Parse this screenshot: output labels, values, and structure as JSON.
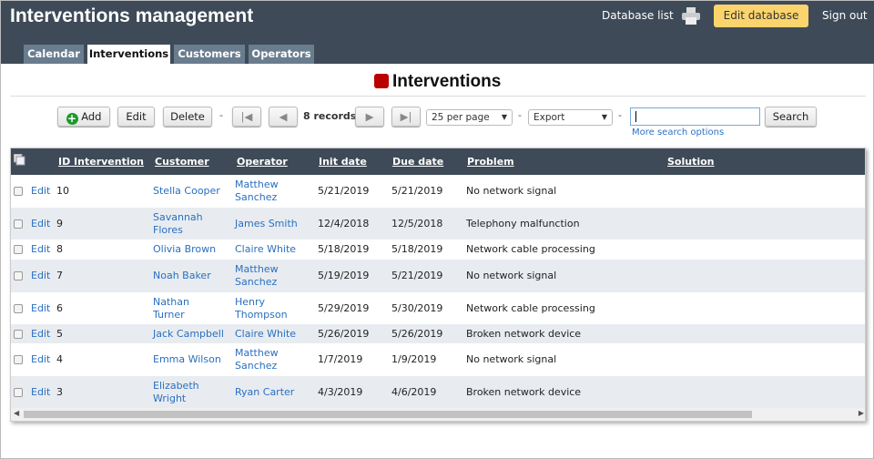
{
  "app": {
    "title": "Interventions management",
    "database_list": "Database list",
    "edit_database": "Edit database",
    "sign_out": "Sign out"
  },
  "tabs": [
    {
      "label": "Calendar"
    },
    {
      "label": "Interventions",
      "active": true
    },
    {
      "label": "Customers"
    },
    {
      "label": "Operators"
    }
  ],
  "page": {
    "title": "Interventions",
    "accent": "#bb0000"
  },
  "toolbar": {
    "add": "Add",
    "edit": "Edit",
    "delete": "Delete",
    "records": "8 records",
    "per_page": "25 per page",
    "export": "Export",
    "search_value": "",
    "search": "Search",
    "more_search": "More search options",
    "sep": "-"
  },
  "table": {
    "columns": [
      "ID Intervention",
      "Customer",
      "Operator",
      "Init date",
      "Due date",
      "Problem",
      "Solution"
    ],
    "edit_label": "Edit",
    "rows": [
      {
        "id": "10",
        "customer": "Stella Cooper",
        "operator": "Matthew Sanchez",
        "init": "5/21/2019",
        "due": "5/21/2019",
        "problem": "No network signal",
        "solution": ""
      },
      {
        "id": "9",
        "customer": "Savannah Flores",
        "operator": "James Smith",
        "init": "12/4/2018",
        "due": "12/5/2018",
        "problem": "Telephony malfunction",
        "solution": ""
      },
      {
        "id": "8",
        "customer": "Olivia Brown",
        "operator": "Claire White",
        "init": "5/18/2019",
        "due": "5/18/2019",
        "problem": "Network cable processing",
        "solution": ""
      },
      {
        "id": "7",
        "customer": "Noah Baker",
        "operator": "Matthew Sanchez",
        "init": "5/19/2019",
        "due": "5/21/2019",
        "problem": "No network signal",
        "solution": ""
      },
      {
        "id": "6",
        "customer": "Nathan Turner",
        "operator": "Henry Thompson",
        "init": "5/29/2019",
        "due": "5/30/2019",
        "problem": "Network cable processing",
        "solution": ""
      },
      {
        "id": "5",
        "customer": "Jack Campbell",
        "operator": "Claire White",
        "init": "5/26/2019",
        "due": "5/26/2019",
        "problem": "Broken network device",
        "solution": ""
      },
      {
        "id": "4",
        "customer": "Emma Wilson",
        "operator": "Matthew Sanchez",
        "init": "1/7/2019",
        "due": "1/9/2019",
        "problem": "No network signal",
        "solution": ""
      },
      {
        "id": "3",
        "customer": "Elizabeth Wright",
        "operator": "Ryan Carter",
        "init": "4/3/2019",
        "due": "4/6/2019",
        "problem": "Broken network device",
        "solution": ""
      }
    ]
  }
}
